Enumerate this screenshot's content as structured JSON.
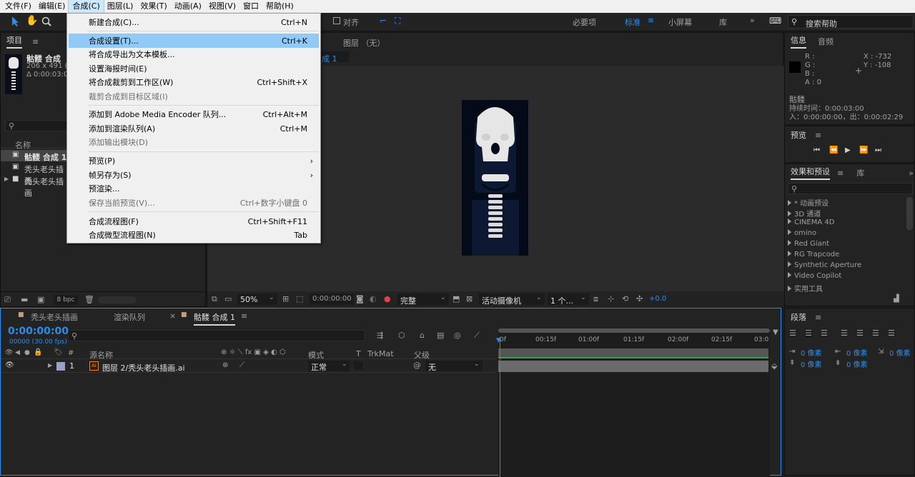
{
  "menubar": {
    "items": [
      "文件(F)",
      "编辑(E)",
      "合成(C)",
      "图层(L)",
      "效果(T)",
      "动画(A)",
      "视图(V)",
      "窗口",
      "帮助(H)"
    ],
    "active_index": 2
  },
  "toolbar": {
    "snap_label": "对齐",
    "workspaces": [
      "必要项",
      "标准",
      "小屏幕",
      "库"
    ],
    "active_workspace": "标准",
    "search_placeholder": "搜索帮助"
  },
  "dropdown": {
    "items": [
      {
        "label": "新建合成(C)...",
        "shortcut": "Ctrl+N",
        "disabled": false,
        "highlight": false
      },
      {
        "label": "合成设置(T)...",
        "shortcut": "Ctrl+K",
        "disabled": false,
        "highlight": true
      },
      {
        "label": "将合成导出为文本模板...",
        "shortcut": "",
        "disabled": false,
        "highlight": false
      },
      {
        "label": "设置海报时间(E)",
        "shortcut": "",
        "disabled": false,
        "highlight": false
      },
      {
        "label": "将合成裁剪到工作区(W)",
        "shortcut": "Ctrl+Shift+X",
        "disabled": false,
        "highlight": false
      },
      {
        "label": "裁剪合成到目标区域(I)",
        "shortcut": "",
        "disabled": true,
        "highlight": false
      },
      {
        "label": "添加到 Adobe Media Encoder 队列...",
        "shortcut": "Ctrl+Alt+M",
        "disabled": false,
        "highlight": false
      },
      {
        "label": "添加到渲染队列(A)",
        "shortcut": "Ctrl+M",
        "disabled": false,
        "highlight": false
      },
      {
        "label": "添加输出模块(D)",
        "shortcut": "",
        "disabled": true,
        "highlight": false
      },
      {
        "label": "预览(P)",
        "shortcut": "",
        "disabled": false,
        "highlight": false,
        "submenu": true
      },
      {
        "label": "帧另存为(S)",
        "shortcut": "",
        "disabled": false,
        "highlight": false,
        "submenu": true
      },
      {
        "label": "预渲染...",
        "shortcut": "",
        "disabled": false,
        "highlight": false
      },
      {
        "label": "保存当前预览(V)...",
        "shortcut": "Ctrl+数字小键盘 0",
        "disabled": true,
        "highlight": false
      },
      {
        "label": "合成流程图(F)",
        "shortcut": "Ctrl+Shift+F11",
        "disabled": false,
        "highlight": false
      },
      {
        "label": "合成微型流程图(N)",
        "shortcut": "Tab",
        "disabled": false,
        "highlight": false
      }
    ]
  },
  "project": {
    "tab": "项目",
    "comp_name": "骷髅 合成",
    "comp_info_1": "206 x 491 (1.",
    "comp_info_2": "Δ 0:00:03:0",
    "col_name": "名称",
    "items": [
      "骷髅 合成 1",
      "秃头老头插画",
      "秃头老头插画"
    ],
    "bpc": "8 bpc"
  },
  "viewer": {
    "layer_label": "图层 （无）",
    "comp_tab_frag": "成 1",
    "zoom": "50%",
    "timecode": "0:00:00:00",
    "resolution": "完整",
    "camera": "活动摄像机",
    "views": "1 个...",
    "exposure": "+0.0"
  },
  "info": {
    "tabs": [
      "信息",
      "音频"
    ],
    "r": "R :",
    "g": "G :",
    "b": "B :",
    "a": "A : 0",
    "x": "X : -732",
    "y": "Y : -108",
    "name": "骷髅",
    "duration": "持续时间：0:00:03:00",
    "inout": "入：0:00:00:00，出：0:00:02:29"
  },
  "preview": {
    "title": "预览"
  },
  "effects": {
    "tabs": [
      "效果和预设",
      "库"
    ],
    "items": [
      "* 动画预设",
      "3D 通道",
      "CINEMA 4D",
      "omino",
      "Red Giant",
      "RG Trapcode",
      "Synthetic Aperture",
      "Video Copilot",
      "实用工具"
    ]
  },
  "timeline": {
    "tabs": [
      "秃头老头插画",
      "渲染队列",
      "骷髅 合成 1"
    ],
    "timecode": "0:00:00:00",
    "frame_info": "00000 (30.00 fps)",
    "col_source": "源名称",
    "col_mode": "模式",
    "col_t": "T",
    "col_trkmat": "TrkMat",
    "col_parent": "父级",
    "layer_num": "1",
    "layer_name": "图层 2/秃头老头插画.ai",
    "layer_mode": "正常",
    "layer_parent": "无",
    "ruler": [
      "0f",
      "00:15f",
      "01:00f",
      "01:15f",
      "02:00f",
      "02:15f",
      "03:0"
    ]
  },
  "paragraph": {
    "title": "段落",
    "px1": "0 像素",
    "px2": "0 像素",
    "px3": "0 像素",
    "px4": "0 像素",
    "px5": "0 像素"
  },
  "colors": {
    "accent": "#2d8ceb",
    "highlight": "#91c9f7",
    "menu_bg": "#f0f0f0",
    "panel_bg": "#232323"
  }
}
